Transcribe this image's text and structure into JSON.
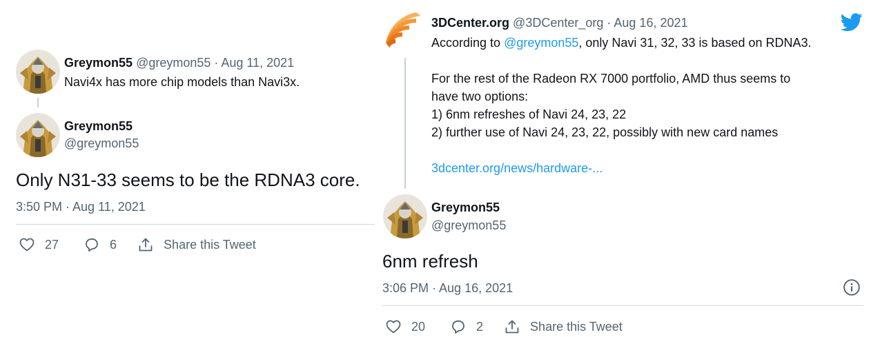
{
  "left": {
    "parent": {
      "author_name": "Greymon55",
      "author_handle": "@greymon55",
      "separator": " · ",
      "date": "Aug 11, 2021",
      "text": "Navi4x has more chip models than Navi3x."
    },
    "main": {
      "author_name": "Greymon55",
      "author_handle": "@greymon55",
      "text": "Only N31-33 seems to be the RDNA3 core.",
      "timestamp": "3:50 PM · Aug 11, 2021",
      "likes": "27",
      "replies": "6",
      "share_label": "Share this Tweet"
    }
  },
  "right": {
    "parent": {
      "author_name": "3DCenter.org",
      "author_handle": "@3DCenter_org",
      "separator": " · ",
      "date": "Aug 16, 2021",
      "line1_prefix": "According to ",
      "line1_mention": "@greymon55",
      "line1_suffix": ", only Navi 31, 32, 33 is based on RDNA3.",
      "line2": "For the rest of the Radeon RX 7000 portfolio, AMD thus seems to",
      "line3": "have two options:",
      "line4": "1) 6nm refreshes of Navi 24, 23, 22",
      "line5": "2) further use of Navi 24, 23, 22, possibly with new card names",
      "link": "3dcenter.org/news/hardware-..."
    },
    "main": {
      "author_name": "Greymon55",
      "author_handle": "@greymon55",
      "text": "6nm refresh",
      "timestamp": "3:06 PM · Aug 16, 2021",
      "likes": "20",
      "replies": "2",
      "share_label": "Share this Tweet"
    }
  },
  "colors": {
    "twitter_blue": "#1d9bf0",
    "text": "#0f1419",
    "muted": "#536471",
    "divider": "#cfd9de"
  },
  "icons": [
    "heart-icon",
    "reply-icon",
    "share-icon",
    "twitter-logo-icon",
    "info-icon",
    "avatar-image"
  ]
}
